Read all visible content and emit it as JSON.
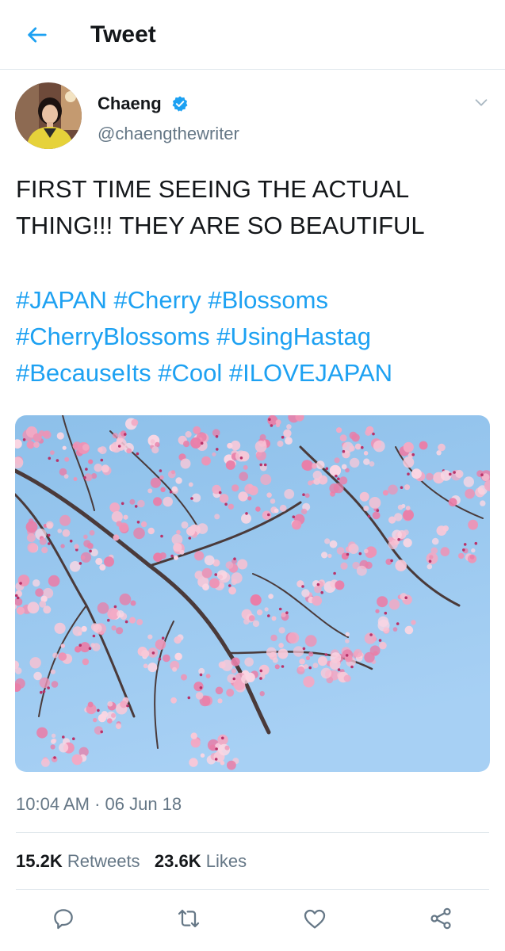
{
  "header": {
    "title": "Tweet",
    "back_icon": "arrow-left-icon",
    "accent_color": "#1da1f2"
  },
  "tweet": {
    "author": {
      "name": "Chaeng",
      "handle": "@chaengthewriter",
      "verified": true
    },
    "text_lines": [
      "FIRST TIME SEEING THE ACTUAL",
      "THING!!! THEY ARE SO BEAUTIFUL"
    ],
    "hashtags": [
      [
        "#JAPAN",
        "#Cherry",
        "#Blossoms"
      ],
      [
        "#CherryBlossoms",
        "#UsingHastag"
      ],
      [
        "#BecauseIts",
        "#Cool",
        "#ILOVEJAPAN"
      ]
    ],
    "timestamp": "10:04 AM · 06 Jun 18",
    "stats": {
      "retweets_count": "15.2K",
      "retweets_label": "Retweets",
      "likes_count": "23.6K",
      "likes_label": "Likes"
    }
  },
  "actions": [
    "reply-icon",
    "retweet-icon",
    "like-icon",
    "share-icon"
  ],
  "colors": {
    "link": "#1da1f2",
    "secondary_text": "#657786",
    "primary_text": "#14171a",
    "divider": "#e1e8ed"
  }
}
